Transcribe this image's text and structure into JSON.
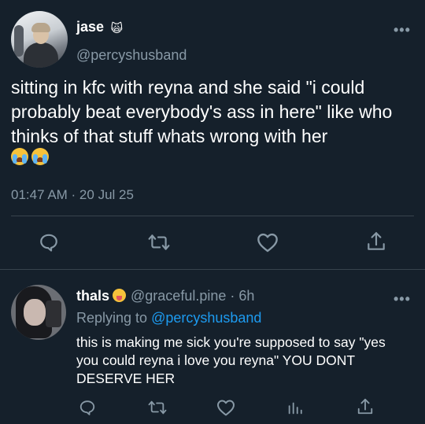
{
  "tweet": {
    "author_name": "jase",
    "author_emoji": "🙀",
    "handle": "@percyshusband",
    "more": "•••",
    "text": "sitting in kfc with reyna and she said \"i could probably beat everybody's  ass in here\" like who thinks of that stuff whats wrong with her",
    "emojis": "😭😭",
    "timestamp": "01:47 AM · 20 Jul 25",
    "actions": [
      "reply-icon",
      "retweet-icon",
      "like-icon",
      "share-icon"
    ]
  },
  "reply": {
    "author_name": "thals",
    "author_emoji": "😛",
    "handle_time": "@graceful.pine · 6h",
    "replying_prefix": "Replying to",
    "replying_to": "@percyshusband",
    "more": "•••",
    "text": "this is making me sick you're supposed to say \"yes you could reyna i love you reyna\" YOU DONT DESERVE HER",
    "actions": [
      "reply-icon",
      "retweet-icon",
      "like-icon",
      "analytics-icon",
      "share-icon"
    ]
  },
  "colors": {
    "background": "#15202b",
    "secondary_text": "#8899a6",
    "link": "#1d9bf0",
    "divider": "#38444d"
  }
}
